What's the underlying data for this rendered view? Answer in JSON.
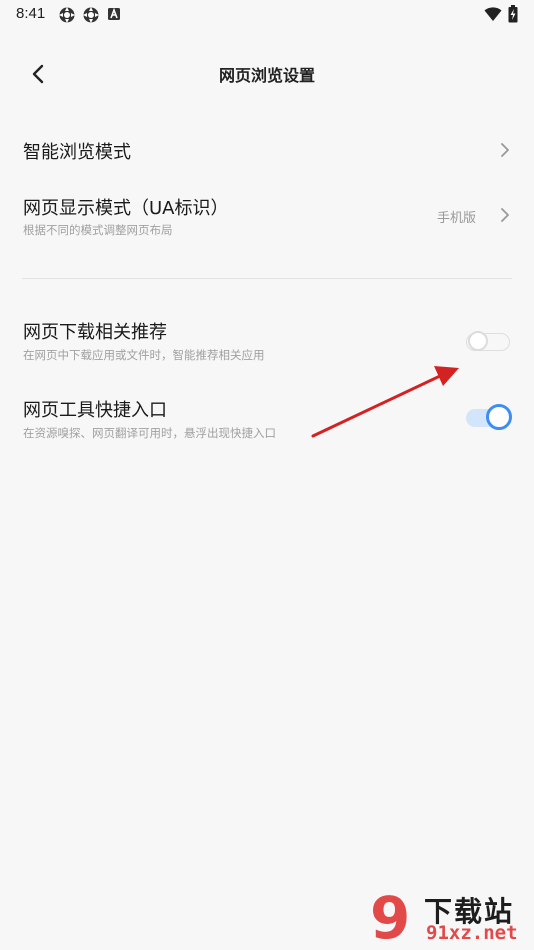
{
  "status_bar": {
    "time": "8:41",
    "left_icons": [
      "settings-gear-icon",
      "settings-gear-icon",
      "letter-a-app-icon"
    ],
    "right_icons": [
      "wifi-icon",
      "battery-charging-icon"
    ]
  },
  "header": {
    "title": "网页浏览设置",
    "back_icon": "back-arrow-icon"
  },
  "settings": {
    "smart_browse": {
      "title": "智能浏览模式"
    },
    "display_mode": {
      "title": "网页显示模式（UA标识）",
      "subtitle": "根据不同的模式调整网页布局",
      "value": "手机版"
    },
    "download_recommend": {
      "title": "网页下载相关推荐",
      "subtitle": "在网页中下载应用或文件时，智能推荐相关应用",
      "enabled": false
    },
    "tool_shortcut": {
      "title": "网页工具快捷入口",
      "subtitle": "在资源嗅探、网页翻译可用时，悬浮出现快捷入口",
      "enabled": true
    }
  },
  "colors": {
    "toggle_on": "#3d8ef0",
    "toggle_on_track": "#d2e5fa",
    "annotation_arrow": "#d42222"
  },
  "watermark": {
    "logo_text": "9",
    "top_text": "下载站",
    "bottom_text": "91xz.net"
  }
}
